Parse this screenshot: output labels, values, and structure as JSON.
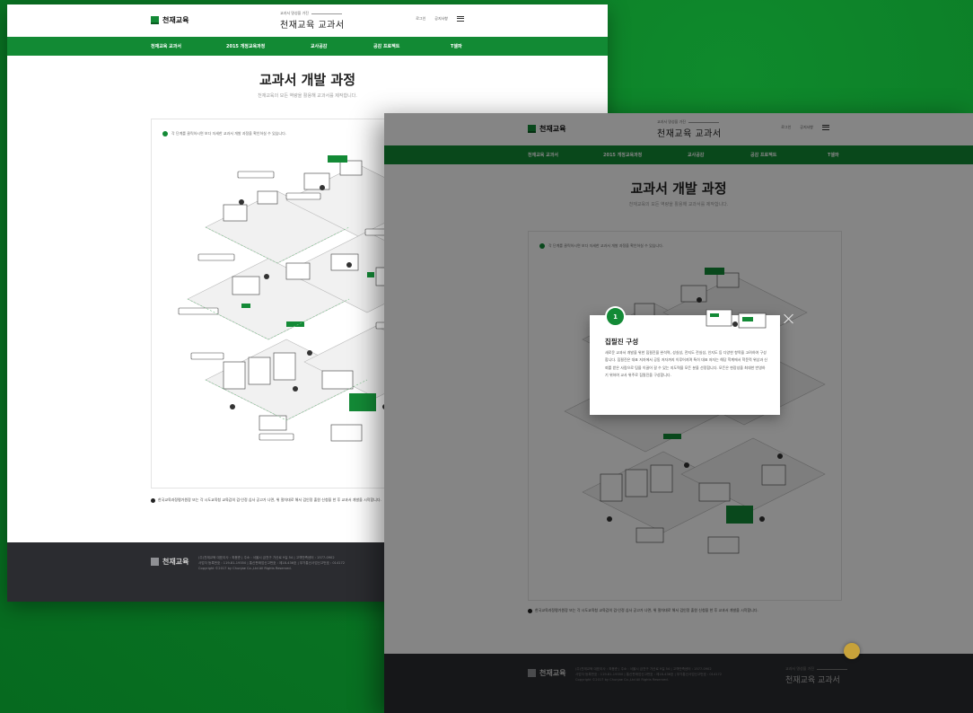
{
  "header": {
    "logo_text": "천재교육",
    "slogan": "교과서 명성을 가진",
    "brand": "천재교육 교과서",
    "login": "로그인",
    "notice": "공지사항",
    "menu_icon": "menu-icon"
  },
  "nav": {
    "items": [
      "천재교육 교과서",
      "2015 개정교육과정",
      "교사공감",
      "공감 프로젝트",
      "T셀파"
    ]
  },
  "main": {
    "title": "교과서 개발 과정",
    "subtitle": "천재교육의 모든 역량을 활용해 교과서를 제작합니다.",
    "hint": "각 단계를 클릭하시면 보다 자세한 교과서 개발 과정을 확인하실 수 있습니다.",
    "note": "한국교육과정평가원장 또는 각 시도교육청 교육감의 검·인정 심사 공고가 나면, 위 절차대로 해서 검인정 출원 신청을 한 후 교과서 개발을 시작합니다."
  },
  "footer": {
    "logo_text": "천재교육",
    "info_lines": [
      "(주)천재교육 대표이사 : 최용준  |  주소 : 서울시 금천구 가산로 9길 54  |  고객만족센터 : 1577-0902",
      "사업자 등록번호 : 119-81-19350  |  통신판매업신고번호 : 제18-436호  |  부가통신사업신고번호 : 014172",
      "Copyright ©2017 by Chunjae Co.,Ltd All Rights Reserved."
    ],
    "slogan": "교과서 명성을 가진",
    "brand": "천재교육 교과서"
  },
  "popup": {
    "step": "1",
    "title": "집필진 구성",
    "body": "새로운 교과서 개발을 위한 집필진을 완석력, 성실성, 전지도 전실성, 인지도 등 다양한 항목을 고려하여 구성합니다. 집필진은 대표 저자에서 공동 저자까지 이루어지며 특히 대표 저자는 해당 학계에서 학문적 위상과 신뢰를 받은 사람으로 팀을 이끌어 갈 수 있는 지도력을 모든 분을 선정합니다. 모든은 현장성을 최대한 반영하기 위하여 교사 위주로 집필진을 구성합니다."
  },
  "colors": {
    "brand_green": "#138a36",
    "footer_dark": "#2b2c30",
    "background_green": "#0b7a26",
    "accent_gold": "#c7a23a"
  }
}
